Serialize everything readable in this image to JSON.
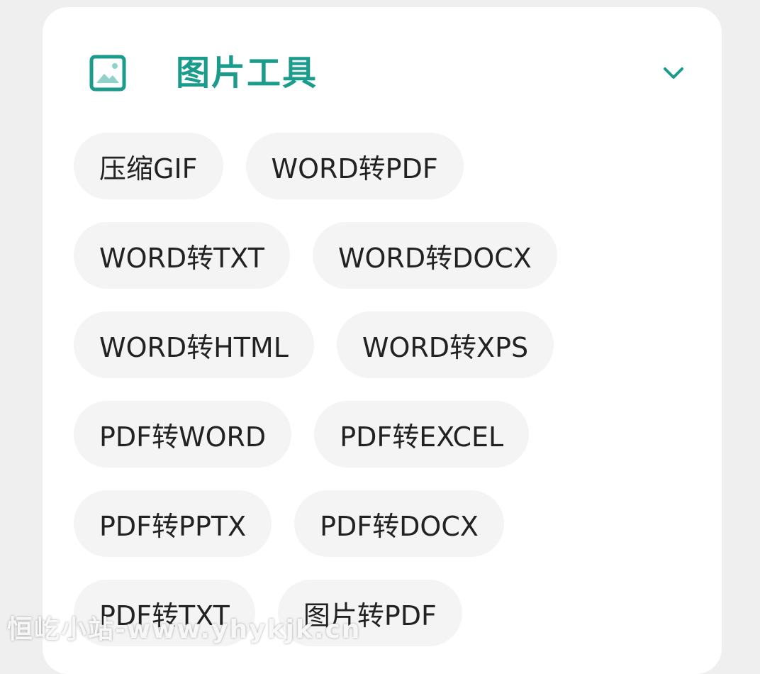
{
  "colors": {
    "accent": "#1a9b8b",
    "chip_bg": "#f4f4f4",
    "chip_text": "#222222"
  },
  "section": {
    "title": "图片工具",
    "icon": "image-icon",
    "toggle_icon": "chevron-down-icon"
  },
  "chips": [
    "压缩GIF",
    "WORD转PDF",
    "WORD转TXT",
    "WORD转DOCX",
    "WORD转HTML",
    "WORD转XPS",
    "PDF转WORD",
    "PDF转EXCEL",
    "PDF转PPTX",
    "PDF转DOCX",
    "PDF转TXT",
    "图片转PDF"
  ],
  "watermark": {
    "text": "恒屹小站-www.yhykjk.cn"
  }
}
